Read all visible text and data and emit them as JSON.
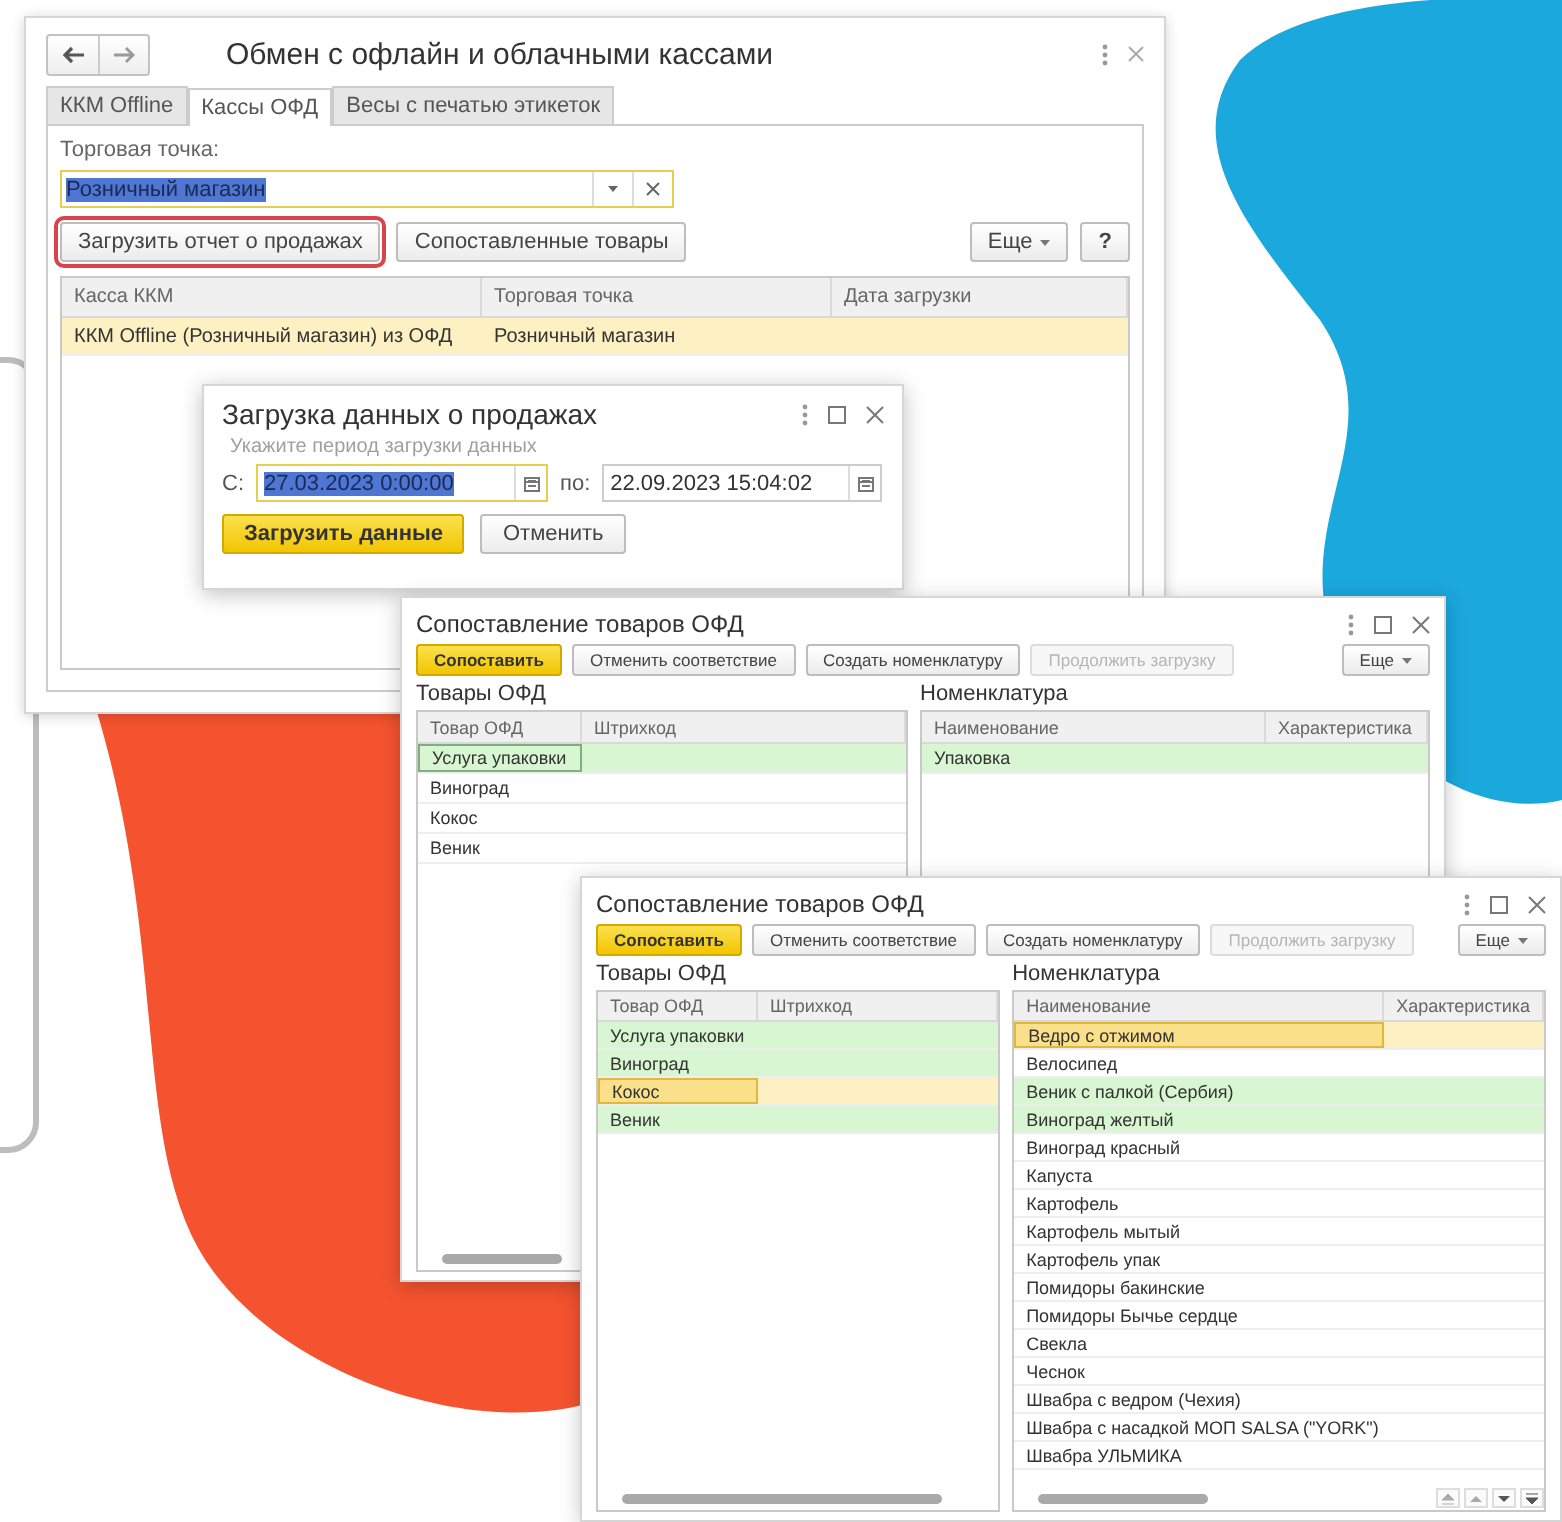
{
  "main_window": {
    "title": "Обмен с офлайн и облачными кассами",
    "tabs": [
      {
        "label": "ККМ Offline",
        "selected": false
      },
      {
        "label": "Кассы ОФД",
        "selected": true
      },
      {
        "label": "Весы с печатью этикеток",
        "selected": false
      }
    ],
    "store_field": {
      "label": "Торговая точка:",
      "value": "Розничный магазин",
      "text_selected": true
    },
    "buttons": [
      {
        "label": "Загрузить отчет о продажах",
        "outlined": true
      },
      {
        "label": "Сопоставленные товары",
        "outlined": false
      }
    ],
    "more_button": "Еще",
    "help_button": "?",
    "table": {
      "columns": [
        "Касса ККМ",
        "Торговая точка",
        "Дата загрузки"
      ],
      "rows": [
        {
          "cells": [
            "ККМ Offline (Розничный магазин) из ОФД",
            "Розничный магазин"
          ],
          "selected": true
        }
      ]
    }
  },
  "load_dialog": {
    "title": "Загрузка данных о продажах",
    "hint": "Укажите период загрузки данных",
    "from": {
      "label": "С:",
      "value": "27.03.2023 0:00:00",
      "text_selected": true
    },
    "to": {
      "label": "по:",
      "value": "22.09.2023 15:04:02",
      "text_selected": false
    },
    "buttons": [
      {
        "label": "Загрузить данные",
        "kind": "primary"
      },
      {
        "label": "Отменить",
        "kind": "default"
      }
    ]
  },
  "matching_windows": [
    {
      "title": "Сопоставление товаров ОФД",
      "buttons": [
        {
          "label": "Сопоставить",
          "kind": "primary"
        },
        {
          "label": "Отменить соответствие",
          "kind": "default"
        },
        {
          "label": "Создать номенклатуру",
          "kind": "default"
        },
        {
          "label": "Продолжить загрузку",
          "kind": "disabled"
        }
      ],
      "more_button": "Еще",
      "left_title": "Товары ОФД",
      "left_columns": [
        "Товар ОФД",
        "Штрихкод"
      ],
      "left_rows": [
        {
          "cells": [
            "Услуга упаковки"
          ],
          "matched": true,
          "selected": false,
          "focused": true
        },
        {
          "cells": [
            "Виноград"
          ],
          "matched": false,
          "selected": false,
          "focused": false
        },
        {
          "cells": [
            "Кокос"
          ],
          "matched": false,
          "selected": false,
          "focused": false
        },
        {
          "cells": [
            "Веник"
          ],
          "matched": false,
          "selected": false,
          "focused": false
        }
      ],
      "right_title": "Номенклатура",
      "right_columns": [
        "Наименование",
        "Характеристика"
      ],
      "right_rows": [
        {
          "cells": [
            "Упаковка"
          ],
          "matched": true,
          "selected": false,
          "focused": false
        }
      ]
    },
    {
      "title": "Сопоставление товаров ОФД",
      "buttons": [
        {
          "label": "Сопоставить",
          "kind": "primary"
        },
        {
          "label": "Отменить соответствие",
          "kind": "default"
        },
        {
          "label": "Создать номенклатуру",
          "kind": "default"
        },
        {
          "label": "Продолжить загрузку",
          "kind": "disabled"
        }
      ],
      "more_button": "Еще",
      "left_title": "Товары ОФД",
      "left_columns": [
        "Товар ОФД",
        "Штрихкод"
      ],
      "left_rows": [
        {
          "cells": [
            "Услуга упаковки"
          ],
          "matched": true,
          "selected": false,
          "focused": false
        },
        {
          "cells": [
            "Виноград"
          ],
          "matched": true,
          "selected": false,
          "focused": false
        },
        {
          "cells": [
            "Кокос"
          ],
          "matched": false,
          "selected": true,
          "focused": true
        },
        {
          "cells": [
            "Веник"
          ],
          "matched": true,
          "selected": false,
          "focused": false
        }
      ],
      "right_title": "Номенклатура",
      "right_columns": [
        "Наименование",
        "Характеристика"
      ],
      "right_rows": [
        {
          "cells": [
            "Ведро с отжимом"
          ],
          "matched": false,
          "selected": true,
          "focused": true
        },
        {
          "cells": [
            "Велосипед"
          ],
          "matched": false,
          "selected": false,
          "focused": false
        },
        {
          "cells": [
            "Веник с палкой (Сербия)"
          ],
          "matched": true,
          "selected": false,
          "focused": false
        },
        {
          "cells": [
            "Виноград желтый"
          ],
          "matched": true,
          "selected": false,
          "focused": false
        },
        {
          "cells": [
            "Виноград красный"
          ],
          "matched": false,
          "selected": false,
          "focused": false
        },
        {
          "cells": [
            "Капуста"
          ],
          "matched": false,
          "selected": false,
          "focused": false
        },
        {
          "cells": [
            "Картофель"
          ],
          "matched": false,
          "selected": false,
          "focused": false
        },
        {
          "cells": [
            "Картофель мытый"
          ],
          "matched": false,
          "selected": false,
          "focused": false
        },
        {
          "cells": [
            "Картофель упак"
          ],
          "matched": false,
          "selected": false,
          "focused": false
        },
        {
          "cells": [
            "Помидоры бакинские"
          ],
          "matched": false,
          "selected": false,
          "focused": false
        },
        {
          "cells": [
            "Помидоры Бычье сердце"
          ],
          "matched": false,
          "selected": false,
          "focused": false
        },
        {
          "cells": [
            "Свекла"
          ],
          "matched": false,
          "selected": false,
          "focused": false
        },
        {
          "cells": [
            "Чеснок"
          ],
          "matched": false,
          "selected": false,
          "focused": false
        },
        {
          "cells": [
            "Швабра с ведром (Чехия)"
          ],
          "matched": false,
          "selected": false,
          "focused": false
        },
        {
          "cells": [
            "Швабра с насадкой МОП SALSA (\"YORK\")"
          ],
          "matched": false,
          "selected": false,
          "focused": false
        },
        {
          "cells": [
            "Швабра УЛЬМИКА"
          ],
          "matched": false,
          "selected": false,
          "focused": false
        }
      ]
    }
  ]
}
